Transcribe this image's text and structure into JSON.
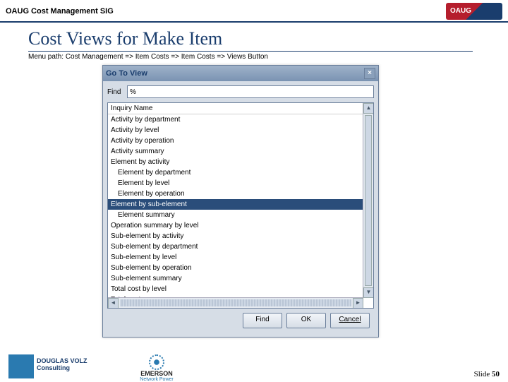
{
  "header": {
    "title": "OAUG Cost Management SIG"
  },
  "slide": {
    "title": "Cost Views for Make Item",
    "menu_path": "Menu path:  Cost Management => Item Costs  => Item Costs => Views Button"
  },
  "dialog": {
    "title": "Go To View",
    "find_label": "Find",
    "find_value": "%",
    "header": "Inquiry Name",
    "selected_index": 8,
    "items": [
      "Activity by department",
      "Activity by level",
      "Activity by operation",
      "Activity summary",
      "Element by activity",
      "Element by department",
      "Element by level",
      "Element by operation",
      "Element by sub-element",
      "Element summary",
      "Operation summary by level",
      "Sub-element by activity",
      "Sub-element by department",
      "Sub-element by level",
      "Sub-element by operation",
      "Sub-element summary",
      "Total cost by level",
      "Total cost summary"
    ],
    "buttons": {
      "find": "Find",
      "ok": "OK",
      "cancel": "Cancel"
    }
  },
  "footer": {
    "slide_label": "Slide ",
    "slide_number": "50"
  }
}
